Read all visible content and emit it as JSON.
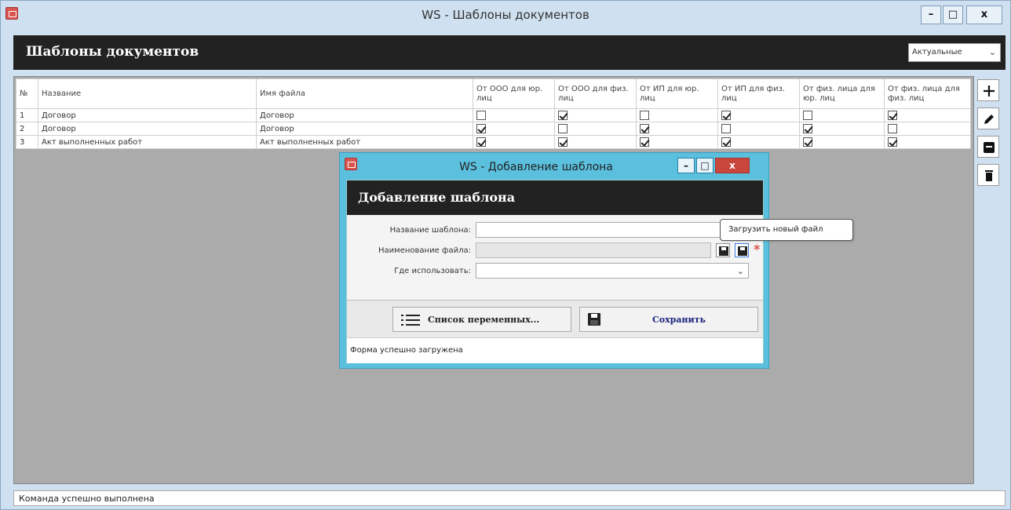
{
  "window": {
    "title": "WS - Шаблоны документов",
    "minimize": "–",
    "maximize": "□",
    "close": "x"
  },
  "header": {
    "title": "Шаблоны документов",
    "filter_value": "Актуальные"
  },
  "table": {
    "columns": [
      "№",
      "Название",
      "Имя файла",
      "От ООО для юр. лиц",
      "От ООО для физ. лиц",
      "От ИП для юр. лиц",
      "От ИП для физ. лиц",
      "От физ. лица для юр. лиц",
      "От физ. лица для физ. лиц"
    ],
    "rows": [
      {
        "num": "1",
        "name": "Договор",
        "file": "Договор",
        "checks": [
          false,
          true,
          false,
          true,
          false,
          true
        ]
      },
      {
        "num": "2",
        "name": "Договор",
        "file": "Договор",
        "checks": [
          true,
          false,
          true,
          false,
          true,
          false
        ]
      },
      {
        "num": "3",
        "name": "Акт выполненных работ",
        "file": "Акт выполненных работ",
        "checks": [
          true,
          true,
          true,
          true,
          true,
          true
        ]
      }
    ]
  },
  "side_tools": [
    "add-icon",
    "edit-icon",
    "archive-icon",
    "delete-icon"
  ],
  "statusbar": "Команда успешно выполнена",
  "dialog": {
    "title": "WS - Добавление шаблона",
    "minimize": "–",
    "maximize": "□",
    "close": "x",
    "header": "Добавление шаблона",
    "fields": {
      "template_name_label": "Название шаблона:",
      "template_name_value": "",
      "file_name_label": "Наименование файла:",
      "file_name_value": "",
      "where_label": "Где использовать:",
      "where_value": ""
    },
    "tooltip": "Загрузить новый файл",
    "vars_button": "Список переменных...",
    "save_button": "Сохранить",
    "status": "Форма успешно загружена"
  },
  "colors": {
    "header_bg": "#222222",
    "dialog_frame": "#5bc0de",
    "close_red": "#c9463d",
    "required": "#d9534f"
  }
}
